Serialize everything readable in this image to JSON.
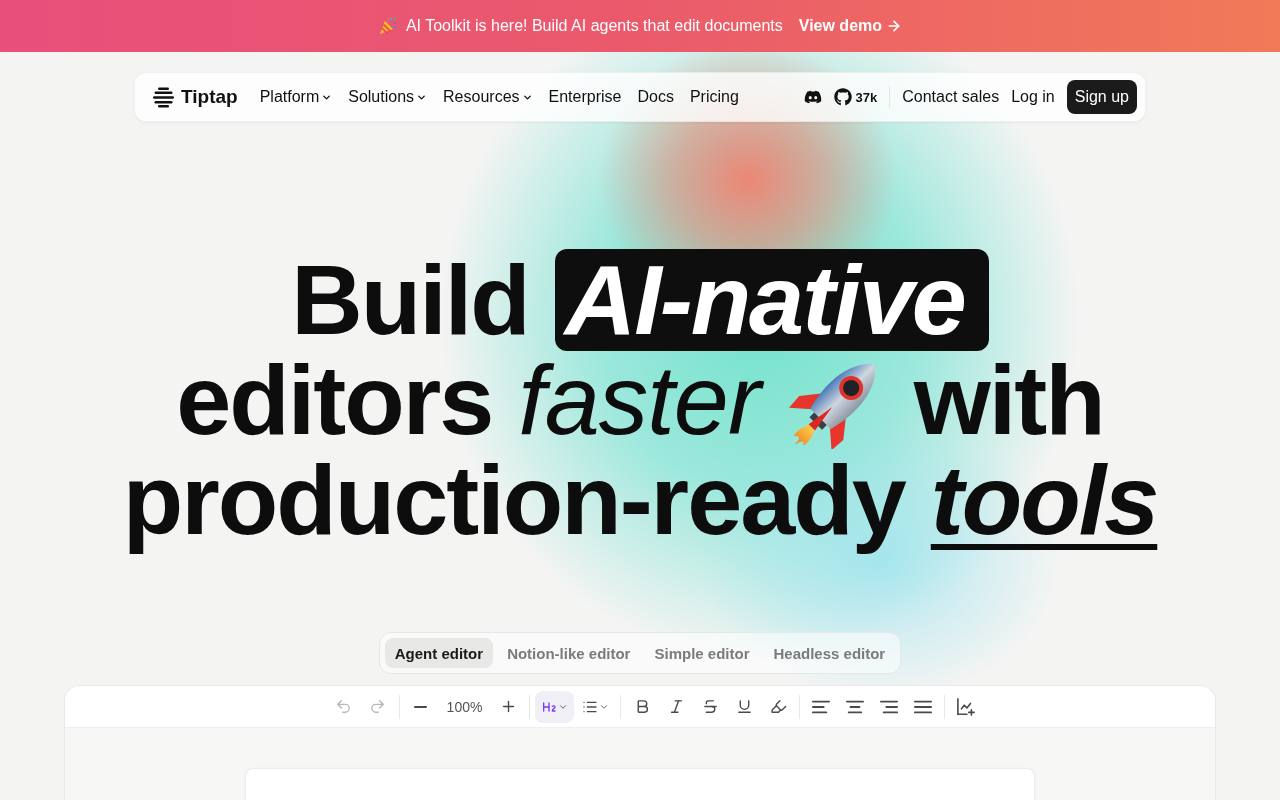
{
  "banner": {
    "text": "AI Toolkit is here! Build AI agents that edit documents",
    "link": "View demo"
  },
  "nav": {
    "logo": "Tiptap",
    "links": [
      {
        "label": "Platform",
        "dropdown": true
      },
      {
        "label": "Solutions",
        "dropdown": true
      },
      {
        "label": "Resources",
        "dropdown": true
      },
      {
        "label": "Enterprise",
        "dropdown": false
      },
      {
        "label": "Docs",
        "dropdown": false
      },
      {
        "label": "Pricing",
        "dropdown": false
      }
    ],
    "github_stars": "37k",
    "actions": [
      {
        "label": "Contact sales",
        "kind": "link"
      },
      {
        "label": "Log in",
        "kind": "link"
      },
      {
        "label": "Sign up",
        "kind": "primary"
      }
    ]
  },
  "headline": {
    "lines": [
      {
        "segments": [
          {
            "text": "Build",
            "kind": "plain"
          },
          {
            "text": "AI-native",
            "kind": "highlight"
          }
        ]
      },
      {
        "segments": [
          {
            "text": "editors",
            "kind": "plain"
          },
          {
            "text": "faster",
            "kind": "italic"
          },
          {
            "kind": "icon"
          },
          {
            "text": "with",
            "kind": "plain"
          }
        ]
      },
      {
        "segments": [
          {
            "text": "production-ready",
            "kind": "plain"
          },
          {
            "text": "tools",
            "kind": "underlined"
          }
        ]
      }
    ]
  },
  "editor_tabs": [
    {
      "label": "Agent editor",
      "selected": true
    },
    {
      "label": "Notion-like editor",
      "selected": false
    },
    {
      "label": "Simple editor",
      "selected": false
    },
    {
      "label": "Headless editor",
      "selected": false
    }
  ],
  "toolbar": {
    "undo": {
      "disabled": true
    },
    "redo": {
      "disabled": true
    },
    "zoom_level": "100%",
    "heading": {
      "active": true
    }
  }
}
